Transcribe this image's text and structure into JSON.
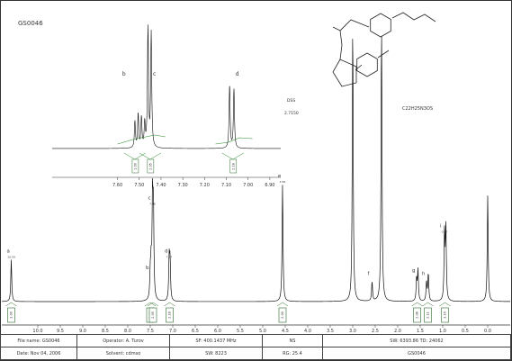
{
  "sample_id": "GS0046",
  "formula": "C22H25N3OS",
  "unknown_label": "DSS",
  "unknown_value": "2.7150",
  "chart_data": [
    {
      "type": "line",
      "name": "main",
      "xlim": [
        10.8,
        -0.5
      ],
      "x_ticks": [
        "10.0",
        "9.5",
        "9.0",
        "8.5",
        "8.0",
        "7.5",
        "7.0",
        "6.5",
        "6.0",
        "5.5",
        "5.0",
        "4.5",
        "4.0",
        "3.5",
        "3.0",
        "2.5",
        "2.0",
        "1.5",
        "1.0",
        "0.5",
        "0.0"
      ],
      "peaks": [
        {
          "ppm": 10.59,
          "height": 0.15,
          "label": "a",
          "value": "10.59"
        },
        {
          "ppm": 7.5,
          "height": 0.09,
          "label": "b"
        },
        {
          "ppm": 7.48,
          "height": 0.12
        },
        {
          "ppm": 7.45,
          "height": 0.34,
          "label": "c",
          "value": "7.46"
        },
        {
          "ppm": 7.43,
          "height": 0.31
        },
        {
          "ppm": 7.08,
          "height": 0.15,
          "label": "d",
          "value": "7.07"
        },
        {
          "ppm": 7.06,
          "height": 0.14
        },
        {
          "ppm": 4.56,
          "height": 0.42,
          "label": "e",
          "value": "4.56"
        },
        {
          "ppm": 3.0,
          "height": 1.0
        },
        {
          "ppm": 2.57,
          "height": 0.07,
          "label": "f"
        },
        {
          "ppm": 2.36,
          "height": 1.0
        },
        {
          "ppm": 1.58,
          "height": 0.08,
          "label": "g"
        },
        {
          "ppm": 1.55,
          "height": 0.11
        },
        {
          "ppm": 1.36,
          "height": 0.07,
          "label": "h"
        },
        {
          "ppm": 1.32,
          "height": 0.1
        },
        {
          "ppm": 0.96,
          "height": 0.24,
          "label": "i",
          "value": "0.97"
        },
        {
          "ppm": 0.93,
          "height": 0.26
        },
        {
          "ppm": 0.0,
          "height": 0.38
        }
      ],
      "integrals": [
        {
          "ppm": 10.59,
          "value": "1.00"
        },
        {
          "ppm": 7.5,
          "value": "1.00"
        },
        {
          "ppm": 7.44,
          "value": "2.05"
        },
        {
          "ppm": 7.07,
          "value": "2.18"
        },
        {
          "ppm": 4.56,
          "value": "2.00"
        },
        {
          "ppm": 1.57,
          "value": "2.08"
        },
        {
          "ppm": 1.33,
          "value": "2.11"
        },
        {
          "ppm": 0.95,
          "value": "3.16"
        }
      ]
    },
    {
      "type": "line",
      "name": "inset",
      "xlim": [
        7.9,
        6.85
      ],
      "x_ticks": [
        "7.60",
        "7.50",
        "7.40",
        "7.30",
        "7.20",
        "7.10",
        "7.00",
        "6.90"
      ],
      "peaks": [
        {
          "ppm": 7.52,
          "height": 0.22
        },
        {
          "ppm": 7.505,
          "height": 0.28
        },
        {
          "ppm": 7.49,
          "height": 0.25
        },
        {
          "ppm": 7.475,
          "height": 0.2
        },
        {
          "ppm": 7.46,
          "height": 1.0
        },
        {
          "ppm": 7.445,
          "height": 0.94
        },
        {
          "ppm": 7.085,
          "height": 0.52
        },
        {
          "ppm": 7.065,
          "height": 0.49
        }
      ],
      "peak_labels": [
        {
          "ppm": 7.57,
          "text": "b"
        },
        {
          "ppm": 7.43,
          "text": "c"
        },
        {
          "ppm": 7.05,
          "text": "d"
        }
      ],
      "integrals": [
        {
          "ppm": 7.52,
          "value": "1.00"
        },
        {
          "ppm": 7.45,
          "value": "2.05"
        },
        {
          "ppm": 7.07,
          "value": "2.18"
        }
      ]
    }
  ],
  "info": {
    "row1": [
      "File name: GS0046",
      "Operator: A. Turov",
      "SF: 400.1437 MHz",
      "NS",
      "SW: 6393.86  TD: 24062"
    ],
    "row2": [
      "Date: Nov 04, 2006",
      "Solvent: cdmso",
      "SW: 8223",
      "RG: 25.4",
      "GS0046"
    ]
  }
}
